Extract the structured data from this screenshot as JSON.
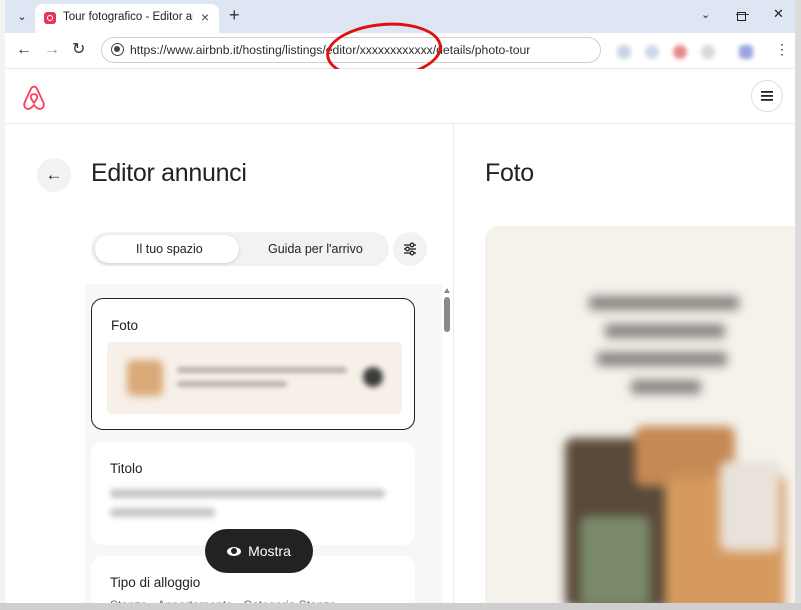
{
  "browser": {
    "tab_title": "Tour fotografico - Editor annunci",
    "url": "https://www.airbnb.it/hosting/listings/editor/xxxxxxxxxxxx/details/photo-tour",
    "icons": {
      "tab_search": "chevron-down-icon",
      "new_tab": "plus-icon",
      "back": "arrow-left-icon",
      "forward": "arrow-right-icon",
      "reload": "reload-icon",
      "menu": "three-dots-icon"
    }
  },
  "annotation": {
    "color": "#e01010"
  },
  "header": {
    "logo": "airbnb-logo",
    "brand_color": "#ff385c",
    "menu_icon": "hamburger-icon"
  },
  "left": {
    "title": "Editor annunci",
    "tabs": [
      {
        "label": "Il tuo spazio",
        "active": true
      },
      {
        "label": "Guida per l'arrivo",
        "active": false
      }
    ],
    "cards": [
      {
        "title": "Foto",
        "selected": true
      },
      {
        "title": "Titolo",
        "selected": false
      },
      {
        "title": "Tipo di alloggio",
        "subtitle": "Stanza · Appartamento · Categoria Stanza",
        "selected": false
      }
    ],
    "show_button": "Mostra"
  },
  "right": {
    "title": "Foto"
  }
}
